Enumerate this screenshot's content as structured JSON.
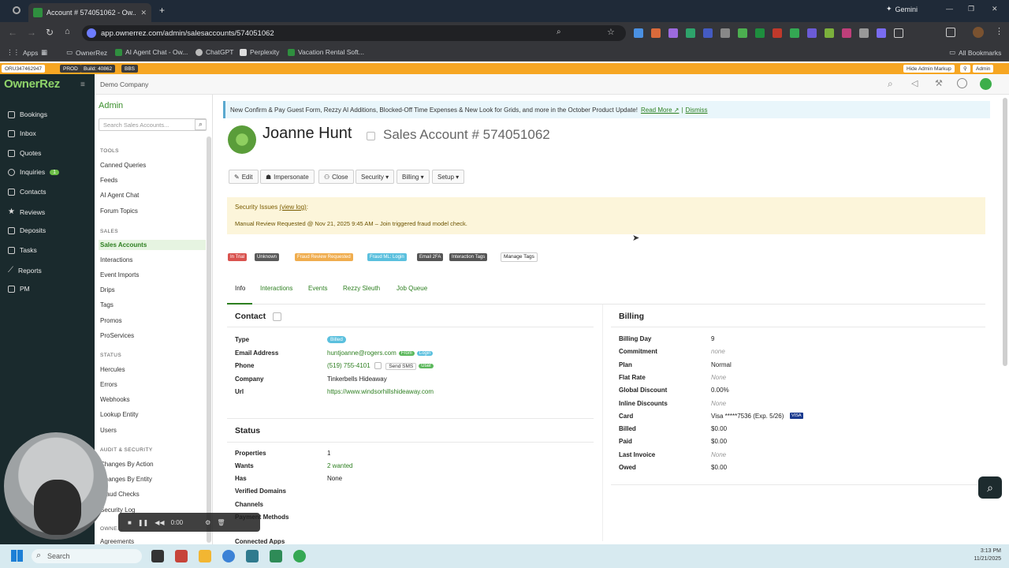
{
  "browser": {
    "tab_title": "Account # 574051062 - Ow...",
    "new_tab": "+",
    "gemini": "Gemini",
    "url": "app.ownerrez.com/admin/salesaccounts/574051062",
    "bookmarks": [
      "Apps",
      "OwnerRez",
      "AI Agent Chat - Ow...",
      "ChatGPT",
      "Perplexity",
      "Vacation Rental Soft..."
    ],
    "all_bookmarks": "All Bookmarks"
  },
  "admin_strip": {
    "env_id": "ORU347462947",
    "prod": "PROD",
    "build": "Build: 40862",
    "bbs": "BBS",
    "hide_markup": "Hide Admin Markup",
    "admin": "Admin"
  },
  "leftnav": {
    "brand": "OwnerRez",
    "items": [
      {
        "label": "Bookings",
        "icon": "calendar-icon"
      },
      {
        "label": "Inbox",
        "icon": "inbox-icon"
      },
      {
        "label": "Quotes",
        "icon": "quotes-icon"
      },
      {
        "label": "Inquiries",
        "icon": "inquiries-icon",
        "badge": "1"
      },
      {
        "label": "Contacts",
        "icon": "contacts-icon"
      },
      {
        "label": "Reviews",
        "icon": "star-icon"
      },
      {
        "label": "Deposits",
        "icon": "bank-icon"
      },
      {
        "label": "Tasks",
        "icon": "tasks-icon"
      },
      {
        "label": "Reports",
        "icon": "chart-icon"
      },
      {
        "label": "PM",
        "icon": "pm-icon"
      }
    ]
  },
  "company": "Demo Company",
  "subnav": {
    "title": "Admin",
    "search_placeholder": "Search Sales Accounts...",
    "sections": {
      "tools": "TOOLS",
      "sales": "SALES",
      "status": "STATUS",
      "audit": "AUDIT & SECURITY",
      "owner": "OWNE..."
    },
    "tools": [
      "Canned Queries",
      "Feeds",
      "AI Agent Chat",
      "Forum Topics"
    ],
    "sales": [
      "Sales Accounts",
      "Interactions",
      "Event Imports",
      "Drips",
      "Tags",
      "Promos",
      "ProServices"
    ],
    "status": [
      "Hercules",
      "Errors",
      "Webhooks",
      "Lookup Entity",
      "Users"
    ],
    "audit": [
      "Changes By Action",
      "Changes By Entity",
      "Fraud Checks",
      "Security Log"
    ],
    "owner": [
      "Agreements"
    ]
  },
  "banner": {
    "text": "New Confirm & Pay Guest Form, Rezzy AI Additions, Blocked-Off Time Expenses & New Look for Grids, and more in the October Product Update!",
    "read_more": "Read More ↗",
    "separator": "|",
    "dismiss": "Dismiss"
  },
  "header": {
    "name": "Joanne Hunt",
    "account": "Sales Account # 574051062"
  },
  "actions": [
    {
      "label": "Edit",
      "icon": "pencil-icon"
    },
    {
      "label": "Impersonate",
      "icon": "user-icon"
    },
    {
      "label": "Close",
      "icon": "close-user-icon"
    },
    {
      "label": "Security ▾"
    },
    {
      "label": "Billing ▾"
    },
    {
      "label": "Setup ▾"
    }
  ],
  "security": {
    "heading": "Security Issues",
    "view_log": "(view log)",
    "colon": ":",
    "detail": "Manual Review Requested @ Nov 21, 2025 9:45 AM – Join triggered fraud model check."
  },
  "tags": [
    {
      "label": "In Trial",
      "color": "#d9534f"
    },
    {
      "label": "Unknown",
      "color": "#5a5a5a"
    },
    {
      "label": "Fraud Review Requested",
      "color": "#f0ad4e"
    },
    {
      "label": "Fraud ML: Login",
      "color": "#5bc0de"
    },
    {
      "label": "Email 2FA",
      "color": "#555555"
    },
    {
      "label": "Interaction Tags",
      "color": "#555555"
    }
  ],
  "manage_tags": "Manage Tags",
  "tabs": [
    "Info",
    "Interactions",
    "Events",
    "Rezzy Sleuth",
    "Job Queue"
  ],
  "contact": {
    "heading": "Contact",
    "labels": [
      "Type",
      "Email Address",
      "Phone",
      "Company",
      "Url"
    ],
    "type": "Billed",
    "email": "huntjoanne@rogers.com",
    "email_badge1": "From",
    "email_badge2": "Login",
    "phone": "(519) 755-4101",
    "send_sms": "Send SMS",
    "phone_badge": "User",
    "company": "Tinkerbells Hideaway",
    "url": "https://www.windsorhillshideaway.com"
  },
  "status": {
    "heading": "Status",
    "labels": [
      "Properties",
      "Wants",
      "Has",
      "Verified Domains",
      "Channels",
      "Payment Methods",
      "Connected Apps"
    ],
    "properties": "1",
    "wants": "2 wanted",
    "has": "None"
  },
  "billing": {
    "heading": "Billing",
    "rows": [
      {
        "label": "Billing Day",
        "value": "9",
        "style": ""
      },
      {
        "label": "Commitment",
        "value": "none",
        "style": "muted"
      },
      {
        "label": "Plan",
        "value": "Normal",
        "style": ""
      },
      {
        "label": "Flat Rate",
        "value": "None",
        "style": "muted"
      },
      {
        "label": "Global Discount",
        "value": "0.00%",
        "style": ""
      },
      {
        "label": "Inline Discounts",
        "value": "None",
        "style": "muted"
      },
      {
        "label": "Card",
        "value": "Visa *****7536 (Exp. 5/26)",
        "style": ""
      },
      {
        "label": "Billed",
        "value": "$0.00",
        "style": ""
      },
      {
        "label": "Paid",
        "value": "$0.00",
        "style": ""
      },
      {
        "label": "Last Invoice",
        "value": "None",
        "style": "muted"
      },
      {
        "label": "Owed",
        "value": "$0.00",
        "style": ""
      }
    ],
    "visa": "VISA"
  },
  "player": {
    "time": "0:00"
  },
  "taskbar": {
    "search": "Search",
    "time": "3:13 PM",
    "date": "11/21/2025"
  }
}
